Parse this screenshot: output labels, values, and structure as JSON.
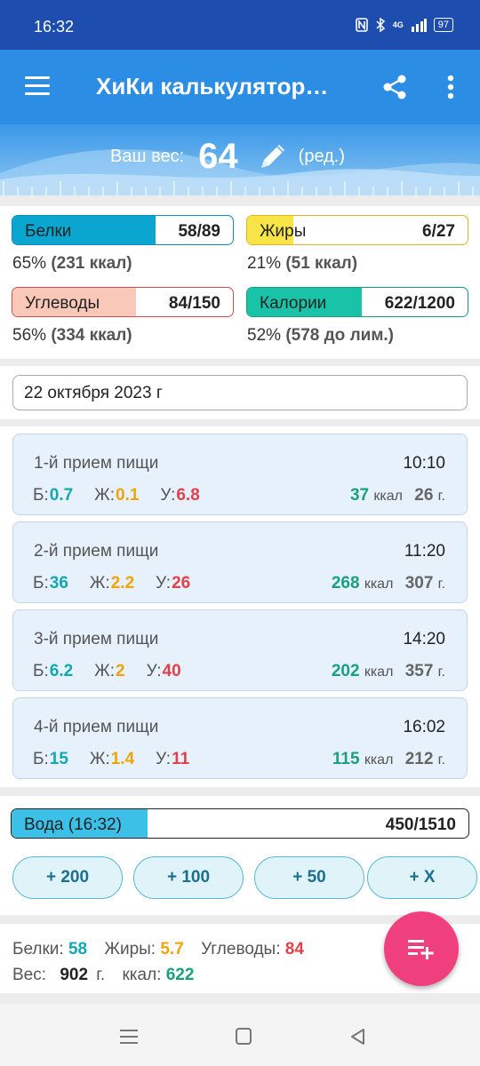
{
  "status": {
    "time": "16:32",
    "signal": "4G",
    "battery": "97"
  },
  "appbar": {
    "title": "ХиКи калькулятор…"
  },
  "weight": {
    "label": "Ваш вес:",
    "value": "64",
    "edit": "(ред.)"
  },
  "macros": [
    {
      "name": "Белки",
      "value": "58/89",
      "percent": "65%",
      "detail": "(231 ккал)",
      "fill": 0.65,
      "color": "#0aa6cf",
      "border": "#0a8fb5"
    },
    {
      "name": "Жиры",
      "value": "6/27",
      "percent": "21%",
      "detail": "(51 ккал)",
      "fill": 0.21,
      "color": "#f7e547",
      "border": "#e2b425"
    },
    {
      "name": "Углеводы",
      "value": "84/150",
      "percent": "56%",
      "detail": "(334 ккал)",
      "fill": 0.56,
      "color": "#f9c8b9",
      "border": "#d94b4b"
    },
    {
      "name": "Калории",
      "value": "622/1200",
      "percent": "52%",
      "detail": "(578 до лим.)",
      "fill": 0.52,
      "color": "#18c3a8",
      "border": "#169c84"
    }
  ],
  "date": "22 октября 2023 г",
  "labels": {
    "b": "Б:",
    "z": "Ж:",
    "u": "У:",
    "kcal": "ккал",
    "gram": "г."
  },
  "meals": [
    {
      "title": "1-й прием пищи",
      "time": "10:10",
      "b": "0.7",
      "z": "0.1",
      "u": "6.8",
      "kcal": "37",
      "weight": "26"
    },
    {
      "title": "2-й прием пищи",
      "time": "11:20",
      "b": "36",
      "z": "2.2",
      "u": "26",
      "kcal": "268",
      "weight": "307"
    },
    {
      "title": "3-й прием пищи",
      "time": "14:20",
      "b": "6.2",
      "z": "2",
      "u": "40",
      "kcal": "202",
      "weight": "357"
    },
    {
      "title": "4-й прием пищи",
      "time": "16:02",
      "b": "15",
      "z": "1.4",
      "u": "11",
      "kcal": "115",
      "weight": "212"
    }
  ],
  "water": {
    "label": "Вода (16:32)",
    "value": "450/1510",
    "fill": 0.298,
    "buttons": [
      "+ 200",
      "+ 100",
      "+ 50",
      "+ X"
    ]
  },
  "totals": {
    "b_label": "Белки:",
    "b": "58",
    "z_label": "Жиры:",
    "z": "5.7",
    "u_label": "Углеводы:",
    "u": "84",
    "w_label": "Вес:",
    "w": "902",
    "w_unit": "г.",
    "k_label": "ккал:",
    "k": "622"
  },
  "icons": {
    "menu": "hamburger-icon",
    "share": "share-icon",
    "more": "more-vert-icon",
    "edit": "pencil-icon",
    "fab": "playlist-add-icon"
  }
}
